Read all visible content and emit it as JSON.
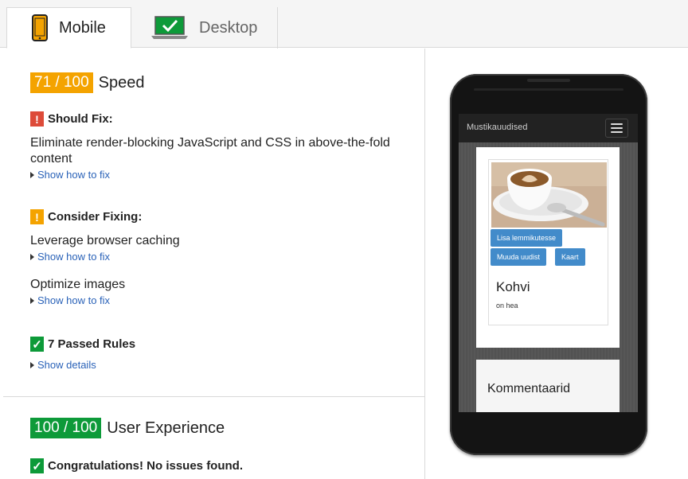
{
  "tabs": [
    {
      "label": "Mobile",
      "active": true
    },
    {
      "label": "Desktop",
      "active": false
    }
  ],
  "colors": {
    "orange": "#f4a300",
    "green": "#0d9a39",
    "red": "#dd4b39",
    "link": "#2a62b8"
  },
  "speed": {
    "score": "71 / 100",
    "label": "Speed",
    "should_fix": {
      "heading": "Should Fix:",
      "rules": [
        {
          "title": "Eliminate render-blocking JavaScript and CSS in above-the-fold content",
          "link": "Show how to fix"
        }
      ]
    },
    "consider_fixing": {
      "heading": "Consider Fixing:",
      "rules": [
        {
          "title": "Leverage browser caching",
          "link": "Show how to fix"
        },
        {
          "title": "Optimize images",
          "link": "Show how to fix"
        }
      ]
    },
    "passed": {
      "heading": "7 Passed Rules",
      "link": "Show details"
    }
  },
  "ux": {
    "score": "100 / 100",
    "label": "User Experience",
    "message": "Congratulations! No issues found."
  },
  "preview": {
    "brand": "Mustikauudised",
    "buttons": [
      "Lisa lemmikutesse",
      "Muuda uudist",
      "Kaart"
    ],
    "post_title": "Kohvi",
    "post_text": "on hea",
    "comments_title": "Kommentaarid"
  }
}
